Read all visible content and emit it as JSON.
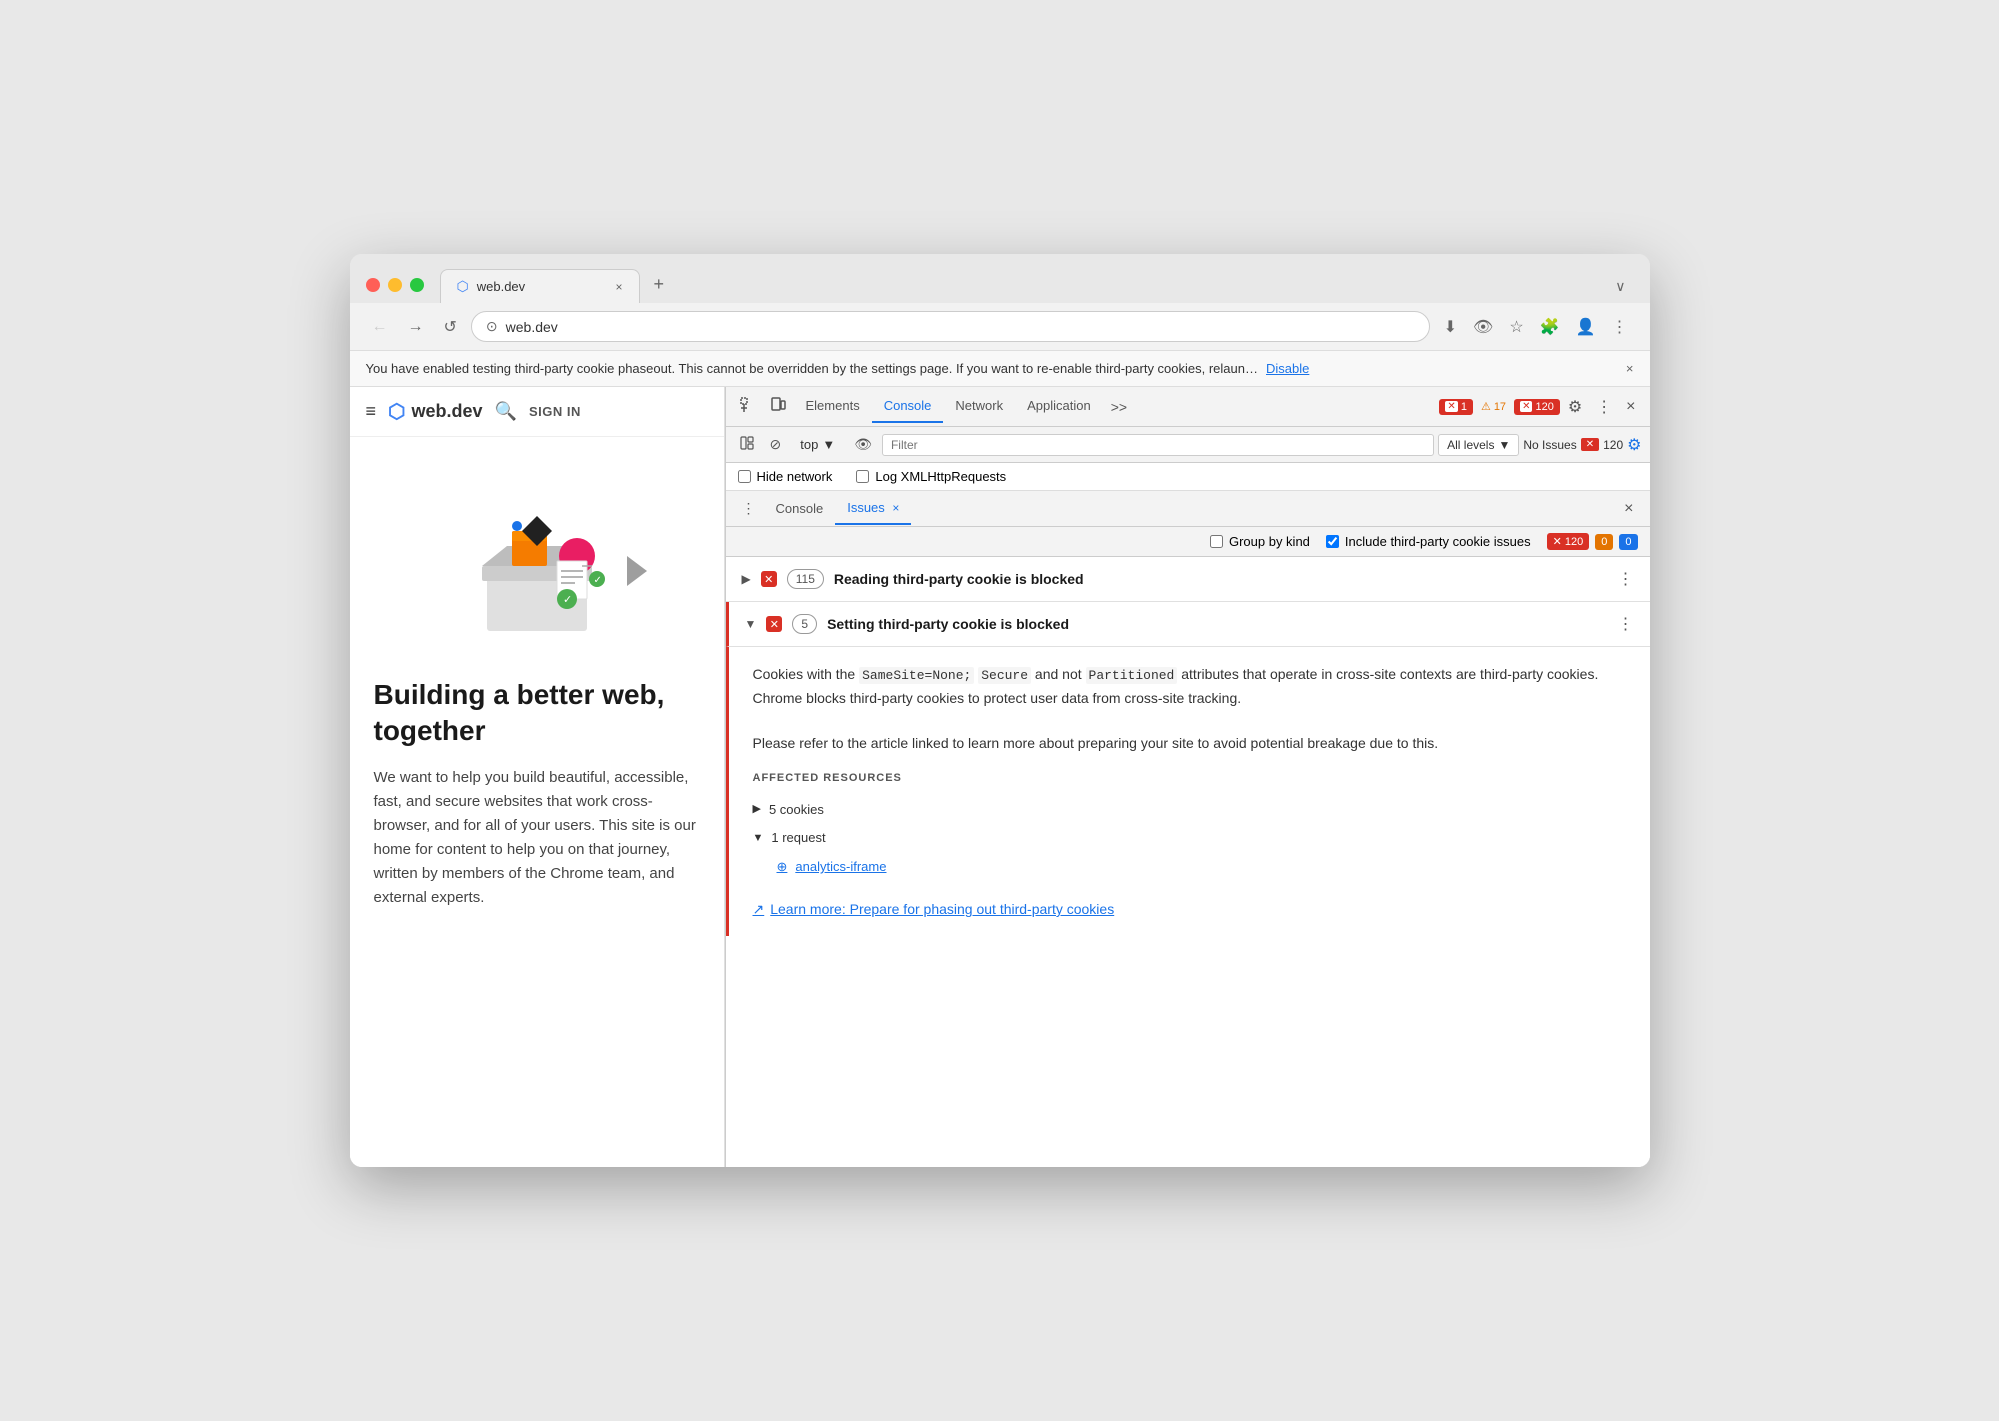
{
  "browser": {
    "tab": {
      "favicon": "⬡",
      "title": "web.dev",
      "close": "×"
    },
    "tab_new": "+",
    "tab_expand": "∨",
    "address": "web.dev",
    "toolbar_icons": {
      "back": "←",
      "forward": "→",
      "refresh": "↺",
      "address_icon": "⊙"
    },
    "action_icons": [
      "⬇",
      "👁",
      "★",
      "🧩",
      "⚙",
      "👤",
      "⋮"
    ],
    "infobar": {
      "text": "You have enabled testing third-party cookie phaseout. This cannot be overridden by the settings page. If you want to re-enable third-party cookies, relaun…",
      "link": "Disable",
      "close": "×"
    }
  },
  "sidebar": {
    "hamburger": "≡",
    "logo": "web.dev",
    "search_icon": "🔍",
    "sign_in": "SIGN IN",
    "hero": {
      "title": "Building a better web, together",
      "text": "We want to help you build beautiful, accessible, fast, and secure websites that work cross-browser, and for all of your users. This site is our home for content to help you on that journey, written by members of the Chrome team, and external experts."
    }
  },
  "devtools": {
    "toolbar": {
      "inspect_icon": "⊹",
      "device_icon": "⬜",
      "tabs": [
        "Elements",
        "Console",
        "Network",
        "Application",
        ">>"
      ],
      "active_tab": "Console",
      "error_count": "1",
      "warning_count": "17",
      "info_count": "120",
      "settings_icon": "⚙",
      "more_icon": "⋮",
      "close_icon": "×"
    },
    "console_toolbar": {
      "sidebar_icon": "⊞",
      "clear_icon": "⊘",
      "context": "top",
      "context_arrow": "▼",
      "eye_icon": "👁",
      "filter_placeholder": "Filter",
      "levels": "All levels",
      "levels_arrow": "▼",
      "no_issues_label": "No Issues",
      "no_issues_count": "120",
      "gear_icon": "⚙"
    },
    "console_options": {
      "hide_network_label": "Hide network",
      "log_xhr_label": "Log XMLHttpRequests"
    },
    "issues_subtabs": {
      "more_icon": "⋮",
      "console_label": "Console",
      "issues_label": "Issues",
      "issues_close": "×",
      "panel_close": "×"
    },
    "issues_options": {
      "group_by_kind_label": "Group by kind",
      "include_third_party_label": "Include third-party cookie issues",
      "error_count": "120",
      "warning_count": "0",
      "info_count": "0"
    },
    "issues": [
      {
        "id": "reading-issue",
        "expanded": false,
        "error_icon": "✕",
        "count": "115",
        "title": "Reading third-party cookie is blocked",
        "more_icon": "⋮"
      },
      {
        "id": "setting-issue",
        "expanded": true,
        "error_icon": "✕",
        "count": "5",
        "title": "Setting third-party cookie is blocked",
        "more_icon": "⋮",
        "body": {
          "paragraph1": "Cookies with the SameSite=None; Secure and not Partitioned attributes that operate in cross-site contexts are third-party cookies. Chrome blocks third-party cookies to protect user data from cross-site tracking.",
          "paragraph2": "Please refer to the article linked to learn more about preparing your site to avoid potential breakage due to this.",
          "code_parts": [
            "SameSite=None;",
            "Secure",
            "Partitioned"
          ],
          "affected_resources_title": "AFFECTED RESOURCES",
          "resource1": {
            "arrow": "▶",
            "text": "5 cookies"
          },
          "resource2": {
            "arrow": "▼",
            "text": "1 request"
          },
          "resource2_sub": {
            "icon": "⊙",
            "text": "analytics-iframe"
          },
          "learn_more": {
            "icon": "↗",
            "text": "Learn more: Prepare for phasing out third-party cookies"
          }
        }
      }
    ]
  }
}
